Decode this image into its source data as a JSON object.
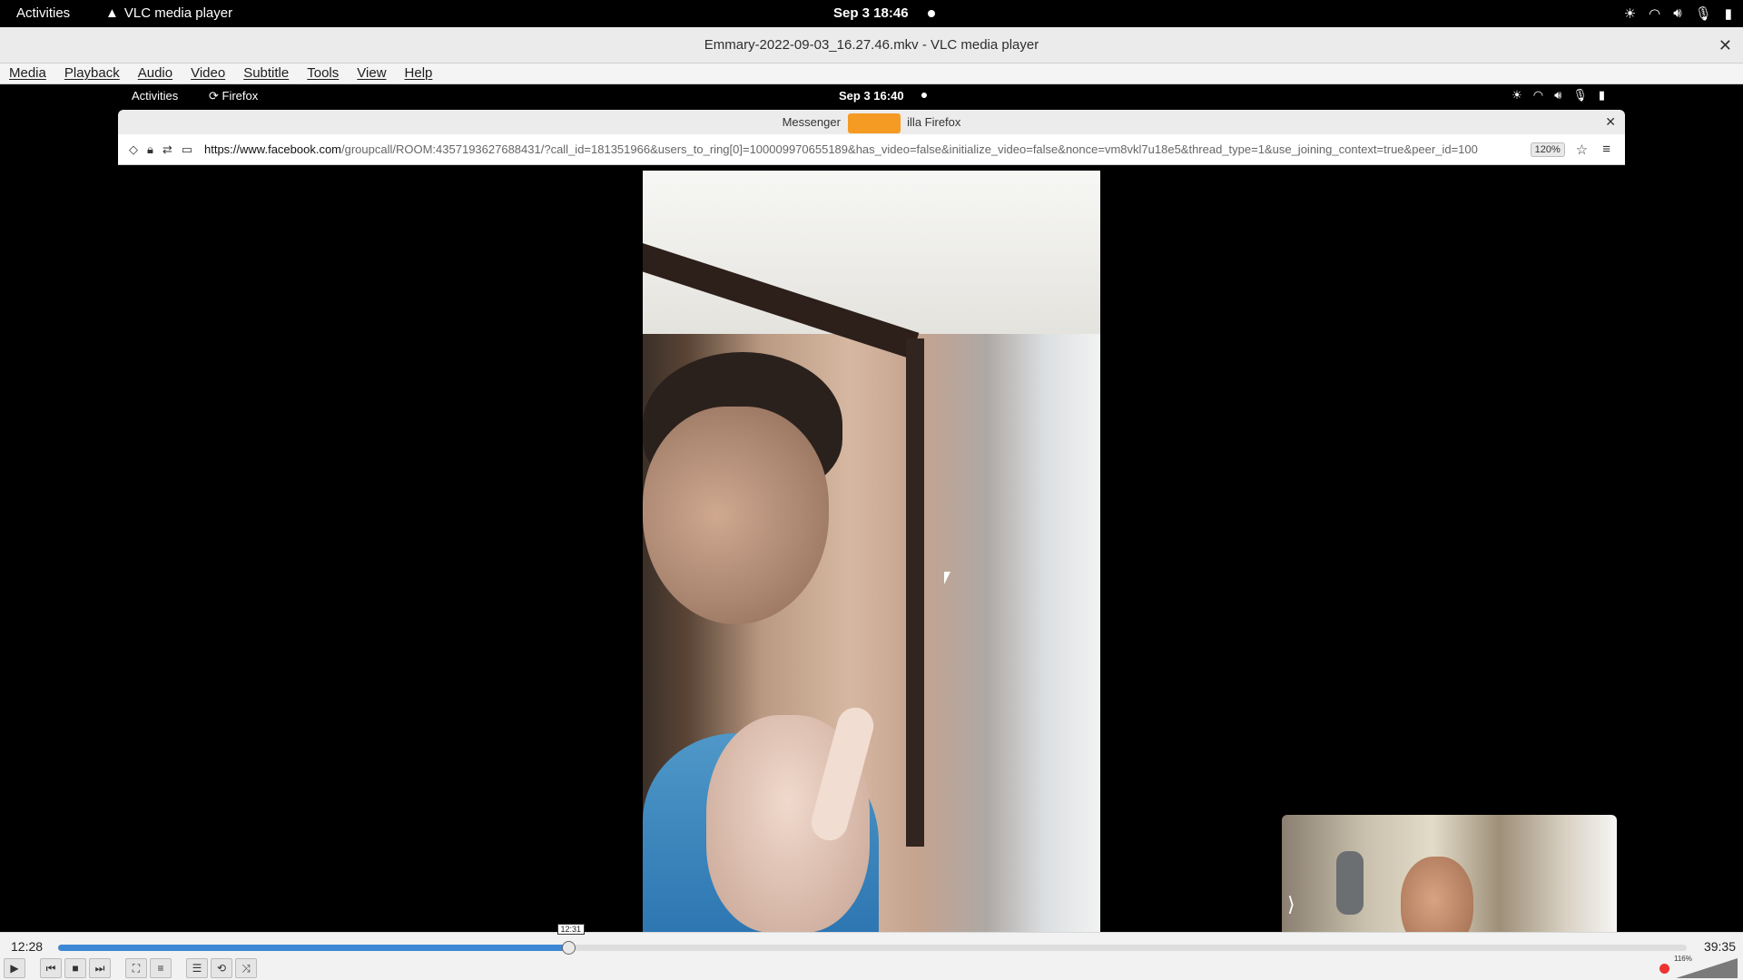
{
  "gnome": {
    "activities": "Activities",
    "app_name": "VLC media player",
    "clock": "Sep 3  18:46"
  },
  "vlc": {
    "window_title": "Emmary-2022-09-03_16.27.46.mkv - VLC media player",
    "menu": [
      "Media",
      "Playback",
      "Audio",
      "Video",
      "Subtitle",
      "Tools",
      "View",
      "Help"
    ],
    "time_elapsed": "12:28",
    "time_total": "39:35",
    "progress_fraction": 0.313,
    "seek_tooltip": "12:31",
    "volume_label": "116%",
    "volume_fraction": 1.0
  },
  "inner_gnome": {
    "activities": "Activities",
    "app_name": "Firefox",
    "clock": "Sep 3  16:40"
  },
  "firefox": {
    "title_left": "Messenger",
    "title_right": "illa Firefox",
    "url_host": "https://www.facebook.com",
    "url_path": "/groupcall/ROOM:4357193627688431/?call_id=181351966&users_to_ring[0]=100009970655189&has_video=false&initialize_video=false&nonce=vm8vkl7u18e5&thread_type=1&use_joining_context=true&peer_id=100",
    "zoom": "120%"
  },
  "icons": {
    "gnome_tray": [
      "brightness-icon",
      "wifi-icon",
      "volume-icon",
      "mic-off-icon",
      "battery-icon"
    ],
    "call_controls": [
      "share-screen-icon",
      "add-person-icon",
      "video-camera-icon",
      "microphone-icon",
      "end-call-icon"
    ]
  },
  "colors": {
    "accent": "#3d87d4",
    "end_call": "#e41e3f",
    "capture_indicator": "#f59a23"
  }
}
